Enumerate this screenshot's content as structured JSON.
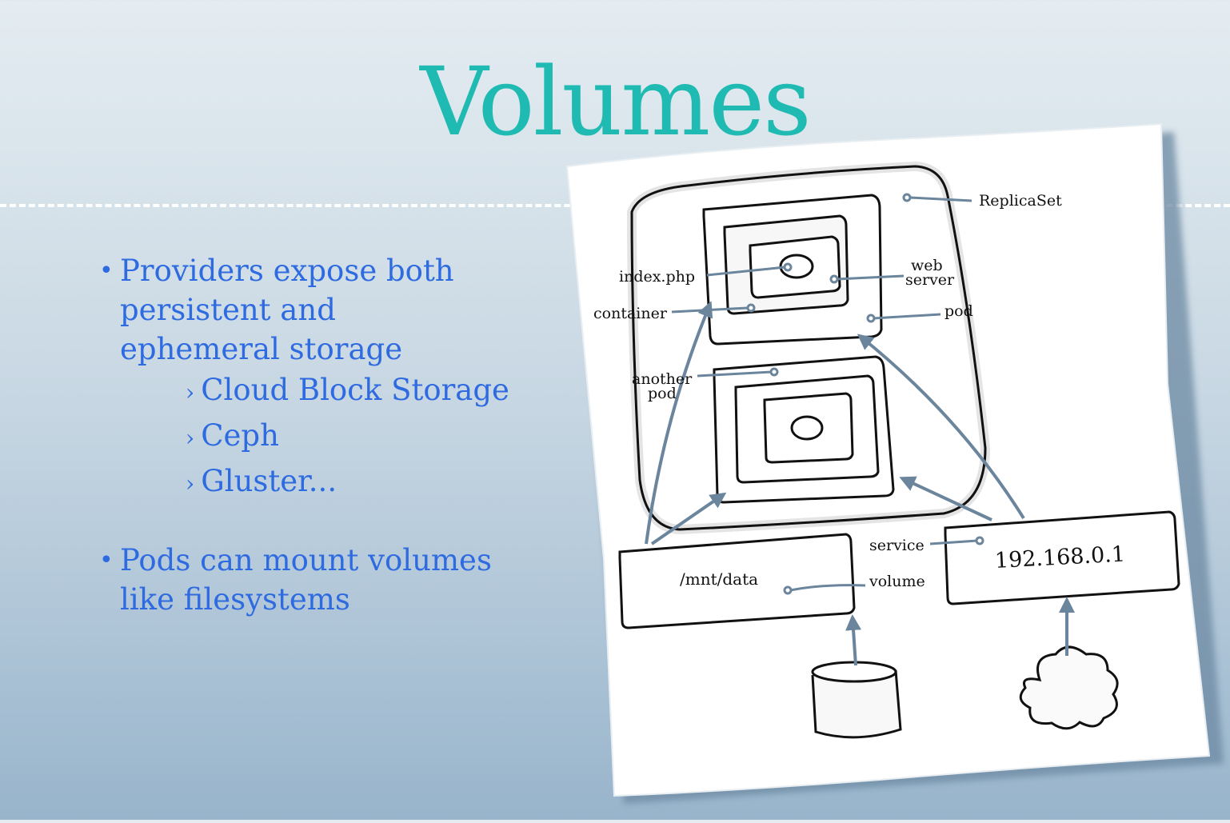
{
  "slide": {
    "title": "Volumes",
    "title_color": "#1fbab2",
    "text_color": "#2f6be0",
    "bullets": [
      {
        "marker": "•",
        "text": "Providers expose both persistent and ephemeral storage",
        "sub_items": [
          {
            "marker": "›",
            "text": "Cloud Block Storage"
          },
          {
            "marker": "›",
            "text": "Ceph"
          },
          {
            "marker": "›",
            "text": "Gluster..."
          }
        ]
      },
      {
        "marker": "•",
        "text": "Pods can mount volumes like filesystems",
        "sub_items": []
      }
    ]
  },
  "diagram": {
    "labels": {
      "replicaset": "ReplicaSet",
      "index_php": "index.php",
      "web": "web",
      "server": "server",
      "container": "container",
      "pod": "pod",
      "another": "another",
      "another_pod": "pod",
      "service": "service",
      "volume": "volume",
      "mount_path": "/mnt/data",
      "ip_address": "192.168.0.1"
    },
    "arrow_color": "#6a859c",
    "icons": [
      "storage-cylinder-icon",
      "cloud-icon"
    ]
  }
}
